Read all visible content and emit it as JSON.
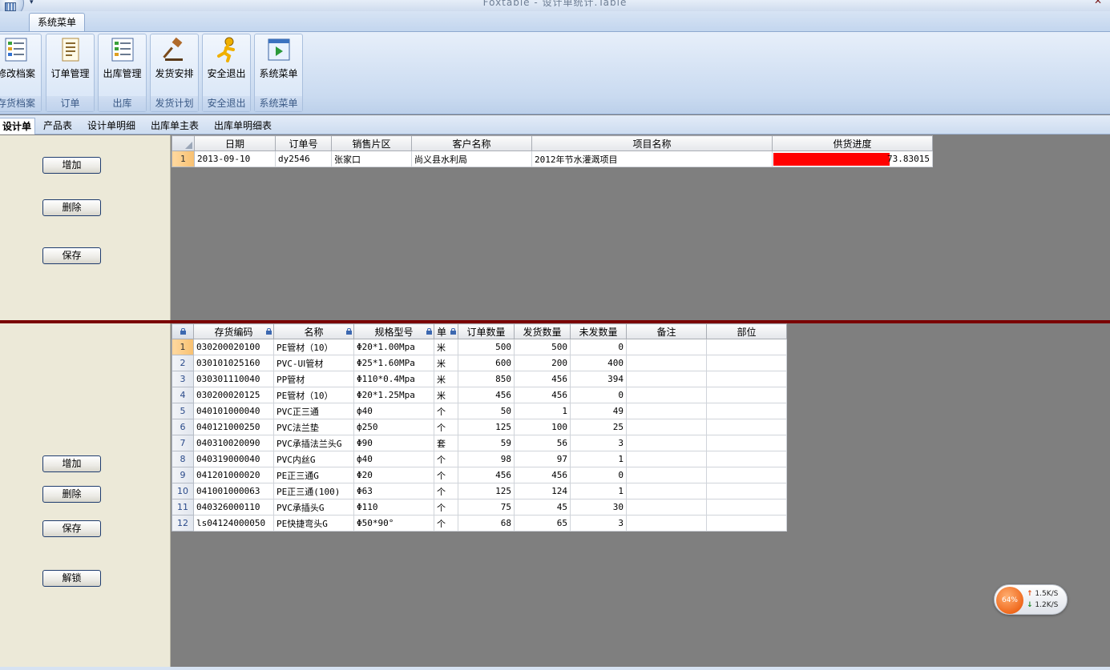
{
  "window": {
    "title": "Foxtable - 设计单统计.Table"
  },
  "ribbon": {
    "tab": "系统菜单",
    "groups": [
      {
        "button": "修改档案",
        "caption": "存货档案",
        "icon": "form-edit-icon"
      },
      {
        "button": "订单管理",
        "caption": "订单",
        "icon": "document-list-icon"
      },
      {
        "button": "出库管理",
        "caption": "出库",
        "icon": "form-list-icon"
      },
      {
        "button": "发货安排",
        "caption": "发货计划",
        "icon": "gavel-icon"
      },
      {
        "button": "安全退出",
        "caption": "安全退出",
        "icon": "running-man-icon"
      },
      {
        "button": "系统菜单",
        "caption": "系统菜单",
        "icon": "window-arrow-icon"
      }
    ]
  },
  "sheet_tabs": [
    "设计单",
    "产品表",
    "设计单明细",
    "出库单主表",
    "出库单明细表"
  ],
  "top_panel": {
    "add": "增加",
    "delete": "删除",
    "save": "保存"
  },
  "bottom_panel": {
    "add": "增加",
    "delete": "删除",
    "save": "保存",
    "unlock": "解锁"
  },
  "top_grid": {
    "columns": [
      "日期",
      "订单号",
      "销售片区",
      "客户名称",
      "项目名称",
      "供货进度"
    ],
    "rows": [
      {
        "n": "1",
        "date": "2013-09-10",
        "order": "dy2546",
        "region": "张家口",
        "customer": "尚义县水利局",
        "project": "2012年节水灌溉项目",
        "progress": "73.83015",
        "progress_fraction": 0.7383
      }
    ],
    "progress_color": "#ff0000"
  },
  "bottom_grid": {
    "columns": [
      "存货编码",
      "名称",
      "规格型号",
      "单",
      "订单数量",
      "发货数量",
      "未发数量",
      "备注",
      "部位"
    ],
    "rows": [
      [
        "1",
        "030200020100",
        "PE管材（10）",
        "Φ20*1.00Mpa",
        "米",
        "500",
        "500",
        "0",
        "",
        ""
      ],
      [
        "2",
        "030101025160",
        "PVC-UⅠ管材",
        "Φ25*1.60MPa",
        "米",
        "600",
        "200",
        "400",
        "",
        ""
      ],
      [
        "3",
        "030301110040",
        "PP管材",
        "Φ110*0.4Mpa",
        "米",
        "850",
        "456",
        "394",
        "",
        ""
      ],
      [
        "4",
        "030200020125",
        "PE管材（10）",
        "Φ20*1.25Mpa",
        "米",
        "456",
        "456",
        "0",
        "",
        ""
      ],
      [
        "5",
        "040101000040",
        "PVC正三通",
        "ф40",
        "个",
        "50",
        "1",
        "49",
        "",
        ""
      ],
      [
        "6",
        "040121000250",
        "PVC法兰垫",
        "ф250",
        "个",
        "125",
        "100",
        "25",
        "",
        ""
      ],
      [
        "7",
        "040310020090",
        "PVC承插法兰头G",
        "Φ90",
        "套",
        "59",
        "56",
        "3",
        "",
        ""
      ],
      [
        "8",
        "040319000040",
        "PVC内丝G",
        "ф40",
        "个",
        "98",
        "97",
        "1",
        "",
        ""
      ],
      [
        "9",
        "041201000020",
        "PE正三通G",
        "Φ20",
        "个",
        "456",
        "456",
        "0",
        "",
        ""
      ],
      [
        "10",
        "041001000063",
        "PE正三通(100)",
        "Φ63",
        "个",
        "125",
        "124",
        "1",
        "",
        ""
      ],
      [
        "11",
        "040326000110",
        "PVC承插头G",
        "Φ110",
        "个",
        "75",
        "45",
        "30",
        "",
        ""
      ],
      [
        "12",
        "ls04124000050",
        "PE快捷弯头G",
        "Φ50*90°",
        "个",
        "68",
        "65",
        "3",
        "",
        ""
      ]
    ]
  },
  "speed_widget": {
    "percent": "64%",
    "up": "1.5K/S",
    "down": "1.2K/S",
    "up_arrow": "↑",
    "down_arrow": "↓"
  }
}
